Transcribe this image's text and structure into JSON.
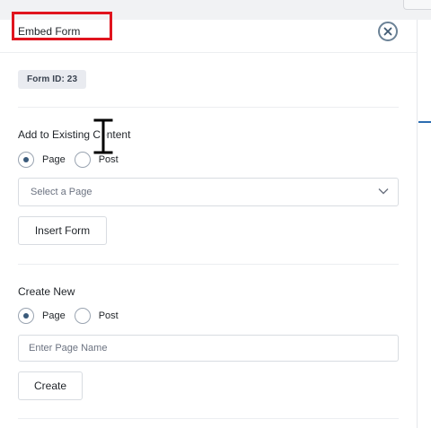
{
  "header": {
    "title": "Embed Form"
  },
  "form": {
    "badge": "Form ID: 23"
  },
  "existing": {
    "title": "Add to Existing Content",
    "options": [
      "Page",
      "Post"
    ],
    "selected": "Page",
    "select_placeholder": "Select a Page",
    "button_label": "Insert Form"
  },
  "create_new": {
    "title": "Create New",
    "options": [
      "Page",
      "Post"
    ],
    "selected": "Page",
    "input_placeholder": "Enter Page Name",
    "button_label": "Create"
  },
  "icons": {
    "close": "close-circle-icon",
    "chevron": "chevron-down-icon",
    "cursor": "text-cursor-icon"
  },
  "colors": {
    "highlight": "#e0141e",
    "accent": "#2b6cb0"
  }
}
